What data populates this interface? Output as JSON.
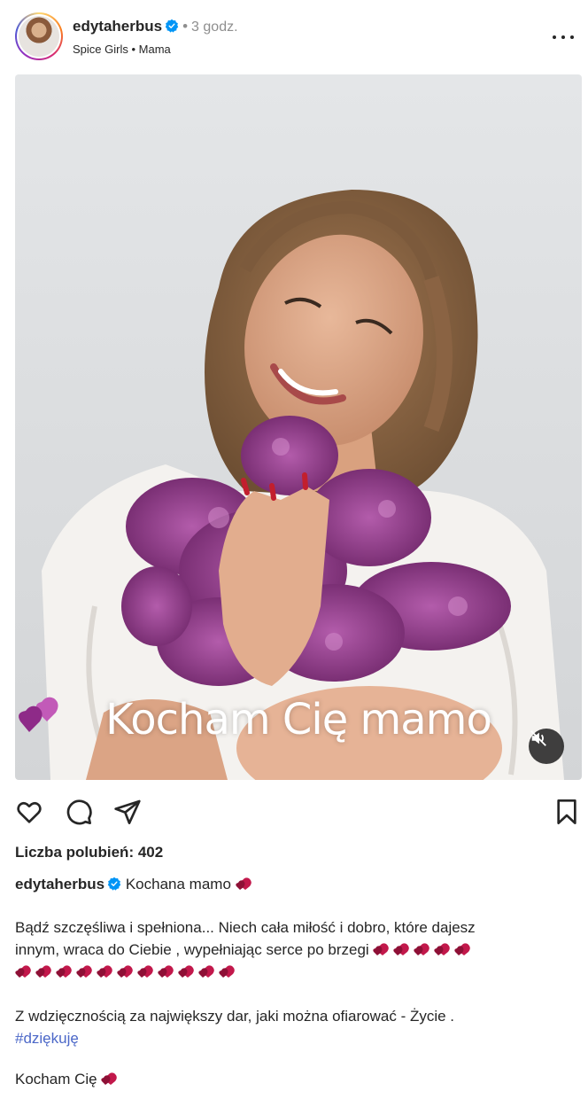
{
  "post": {
    "username": "edytaherbus",
    "time": "3 godz.",
    "audio": "Spice Girls",
    "location": "Mama",
    "overlay_text": "Kocham Cię mamo",
    "likes_label": "Liczba polubień: 402",
    "caption_title": "Kochana mamo",
    "para1_line1": "Bądź szczęśliwa i spełniona... Niech cała miłość i dobro, które dajesz",
    "para1_line2": "innym, wraca do Ciebie , wypełniając serce po brzegi",
    "para2_line1": "Z wdzięcznością za największy dar, jaki można ofiarować - Życie .",
    "hashtag": "#dziękuję",
    "closing": "Kocham Cię",
    "separator": "•"
  },
  "icons": {
    "verified": "verified-badge-icon",
    "more": "more-options-icon",
    "like": "heart-outline-icon",
    "comment": "comment-bubble-icon",
    "share": "paper-plane-icon",
    "save": "bookmark-icon",
    "mute": "speaker-muted-icon",
    "emoji": "double-heart-emoji"
  },
  "colors": {
    "text": "#262626",
    "muted": "#8e8e8e",
    "verified": "#0095f6",
    "hashtag": "#4c68c8",
    "heart_emoji": "#c2184b"
  }
}
